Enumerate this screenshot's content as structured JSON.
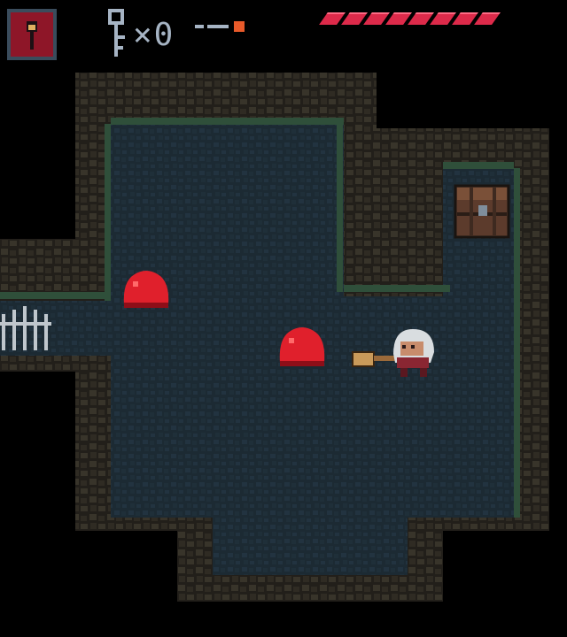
{
  "hud": {
    "portrait_icon": "hero-portrait-icon",
    "key_icon": "key-icon",
    "key_count": "x0",
    "weapon_icon": "arrow-ammo-icon",
    "health_segments": 8,
    "health_filled": 8,
    "health_color": "#dd2a4a"
  },
  "room": {
    "floor_color": "#1c2a33",
    "wall_color": "#2d2a22",
    "moss_color": "#2f4f3a",
    "exits": [
      "west-gate"
    ],
    "gate_icon": "iron-gate-icon",
    "chest_icon": "treasure-chest-icon"
  },
  "entities": {
    "player_icon": "white-haired-hero-icon",
    "weapon": "wooden-hammer-icon",
    "enemies": [
      {
        "type": "red-slime",
        "color": "#e0202c"
      },
      {
        "type": "red-slime",
        "color": "#e0202c"
      }
    ]
  }
}
